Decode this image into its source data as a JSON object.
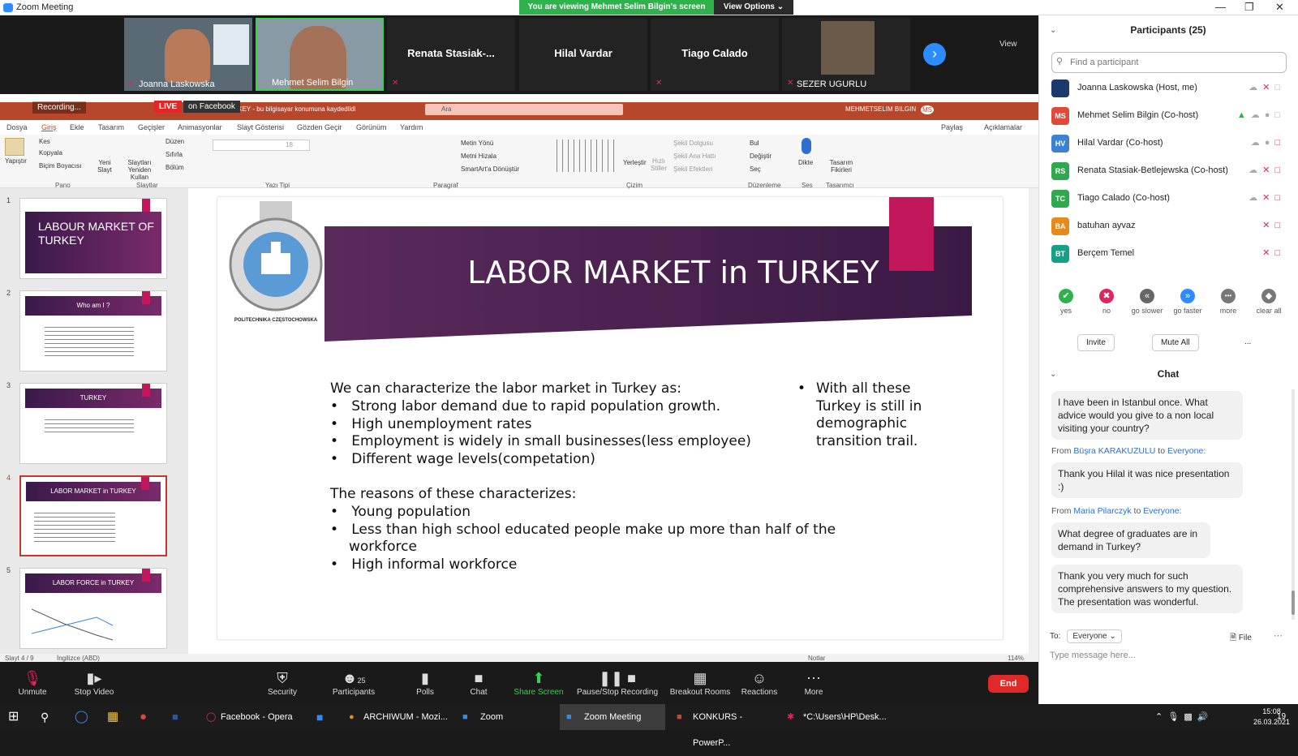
{
  "window": {
    "title": "Zoom Meeting",
    "viewing_banner": "You are viewing Mehmet Selim Bilgin's screen",
    "view_options": "View Options ⌄",
    "strip_view": "View"
  },
  "video_strip": [
    {
      "name": "Joanna Laskowska",
      "has_video": true
    },
    {
      "name": "Mehmet Selim Bilgin",
      "has_video": true
    },
    {
      "name": "Renata  Stasiak-...",
      "has_video": false
    },
    {
      "name": "Hilal Vardar",
      "has_video": false
    },
    {
      "name": "Tiago Calado",
      "has_video": false
    },
    {
      "name": "SEZER UGURLU",
      "has_video": true
    }
  ],
  "share": {
    "recording": "Recording...",
    "live": "LIVE",
    "on_facebook": "on Facebook",
    "ppt_title": "...T OF TURKEY - bu bilgisayar konumuna kaydedildi",
    "search": "Ara",
    "user": "MEHMETSELIM BILGIN",
    "user_initials": "MS",
    "menu": [
      "Dosya",
      "Giriş",
      "Ekle",
      "Tasarım",
      "Geçişler",
      "Animasyonlar",
      "Slayt Gösterisi",
      "Gözden Geçir",
      "Görünüm",
      "Yardım"
    ],
    "share_btn": "Paylaş",
    "comments_btn": "Açıklamalar",
    "ribbon_groups": [
      "Pano",
      "Slaytlar",
      "Yazı Tipi",
      "Paragraf",
      "Çizim",
      "Düzenleme",
      "Ses",
      "Tasarımcı"
    ],
    "ribbon_items": {
      "paste": "Yapıştır",
      "cut": "Kes",
      "copy": "Kopyala",
      "format_painter": "Biçim Boyacısı",
      "new_slide": "Yeni Slayt",
      "reuse": "Slaytları Yeniden Kullan",
      "layout": "Düzen",
      "reset": "Sıfırla",
      "section": "Bölüm",
      "text_dir": "Metin Yönü",
      "align_text": "Metni Hizala",
      "smartart": "SmartArt'a Dönüştür",
      "arrange": "Yerleştir",
      "quick_styles": "Hızlı Stiller",
      "shape_fill": "Şekil Dolgusu",
      "shape_outline": "Şekil Ana Hattı",
      "shape_effects": "Şekil Efektleri",
      "find": "Bul",
      "replace": "Değiştir",
      "select": "Seç",
      "dictate": "Dikte",
      "designer": "Tasarım Fikirleri",
      "font_size": "18"
    },
    "thumbnails": [
      {
        "num": "1",
        "title": "LABOUR MARKET OF TURKEY"
      },
      {
        "num": "2",
        "title": "Who am I ?"
      },
      {
        "num": "3",
        "title": "TURKEY"
      },
      {
        "num": "4",
        "title": "LABOR MARKET in TURKEY"
      },
      {
        "num": "5",
        "title": "LABOR FORCE in TURKEY"
      }
    ],
    "slide": {
      "title": "LABOR MARKET in TURKEY",
      "logo_text": "POLITECHNIKA CZĘSTOCHOWSKA",
      "intro": "We can characterize the labor market in Turkey as:",
      "bullets1": [
        "Strong labor demand due to rapid population growth.",
        "High unemployment rates",
        "Employment is widely in small businesses(less employee)",
        "Different wage levels(competation)"
      ],
      "reasons_intro": "The reasons of these characterizes:",
      "bullets2": [
        "Young population",
        "Less than high school educated people make up more than half of the",
        "High informal workforce"
      ],
      "bullets2_cont": "workforce",
      "side_lines": [
        "With all these",
        "Turkey  is still in",
        "demographic",
        "transition trail."
      ]
    },
    "status": {
      "slide_num": "Slayt 4 / 9",
      "language": "İngilizce (ABD)",
      "notes": "Notlar",
      "zoom": "114%"
    }
  },
  "participants": {
    "title": "Participants (25)",
    "find_placeholder": "Find a participant",
    "list": [
      {
        "initials": "",
        "name": "Joanna Laskowska (Host, me)",
        "color": "#1b3a6b"
      },
      {
        "initials": "MS",
        "name": "Mehmet Selim Bilgin (Co-host)",
        "color": "#e04a3b"
      },
      {
        "initials": "HV",
        "name": "Hilal Vardar (Co-host)",
        "color": "#3b82d1"
      },
      {
        "initials": "RS",
        "name": "Renata Stasiak-Betlejewska (Co-host)",
        "color": "#2fa84f"
      },
      {
        "initials": "TC",
        "name": "Tiago Calado (Co-host)",
        "color": "#2fa84f"
      },
      {
        "initials": "BA",
        "name": "batuhan ayvaz",
        "color": "#e58a1f"
      },
      {
        "initials": "BT",
        "name": "Berçem Temel",
        "color": "#16a085"
      }
    ],
    "reactions": [
      {
        "label": "yes",
        "glyph": "✔",
        "color": "#2fb24c"
      },
      {
        "label": "no",
        "glyph": "✖",
        "color": "#e0245e"
      },
      {
        "label": "go slower",
        "glyph": "«",
        "color": "#666"
      },
      {
        "label": "go faster",
        "glyph": "»",
        "color": "#2d8cff"
      },
      {
        "label": "more",
        "glyph": "•••",
        "color": "#777"
      },
      {
        "label": "clear all",
        "glyph": "◆",
        "color": "#777"
      }
    ],
    "invite": "Invite",
    "mute_all": "Mute All",
    "more": "..."
  },
  "chat": {
    "title": "Chat",
    "msg1": "I have been in Istanbul once. What advice would you give to a non local visiting your country?",
    "from2_prefix": "From ",
    "from2_user": "Büşra KARAKUZULU",
    "from2_to": " to ",
    "from2_target": "Everyone:",
    "msg2": "Thank you Hilal it was nice presentation :)",
    "from3_prefix": "From ",
    "from3_user": "Maria Pilarczyk",
    "from3_to": " to ",
    "from3_target": "Everyone:",
    "msg3": "What degree of graduates are in demand in Turkey?",
    "msg4": "Thank you very much for such comprehensive answers to my question. The presentation was wonderful.",
    "to_label": "To:",
    "to_value": "Everyone ⌄",
    "file": "File",
    "placeholder": "Type message here..."
  },
  "toolbar": [
    {
      "label": "Unmute",
      "icon": "microphone-muted-icon"
    },
    {
      "label": "Stop Video",
      "icon": "video-camera-icon"
    },
    {
      "label": "Security",
      "icon": "shield-icon"
    },
    {
      "label": "Participants",
      "icon": "people-icon"
    },
    {
      "label": "Polls",
      "icon": "bar-chart-icon"
    },
    {
      "label": "Chat",
      "icon": "chat-bubble-icon"
    },
    {
      "label": "Share Screen",
      "icon": "share-screen-icon"
    },
    {
      "label": "Pause/Stop Recording",
      "icon": "pause-stop-icon"
    },
    {
      "label": "Breakout Rooms",
      "icon": "grid-icon"
    },
    {
      "label": "Reactions",
      "icon": "smiley-icon"
    },
    {
      "label": "More",
      "icon": "ellipsis-icon"
    }
  ],
  "participant_count": "25",
  "end": "End",
  "taskbar": [
    {
      "label": "Facebook - Opera"
    },
    {
      "label": "ARCHIWUM - Mozi..."
    },
    {
      "label": "Zoom"
    },
    {
      "label": "Zoom Meeting"
    },
    {
      "label": "KONKURS - PowerP..."
    },
    {
      "label": "*C:\\Users\\HP\\Desk..."
    }
  ],
  "clock": {
    "time": "15:08",
    "date": "26.03.2021",
    "notifications": "19"
  }
}
